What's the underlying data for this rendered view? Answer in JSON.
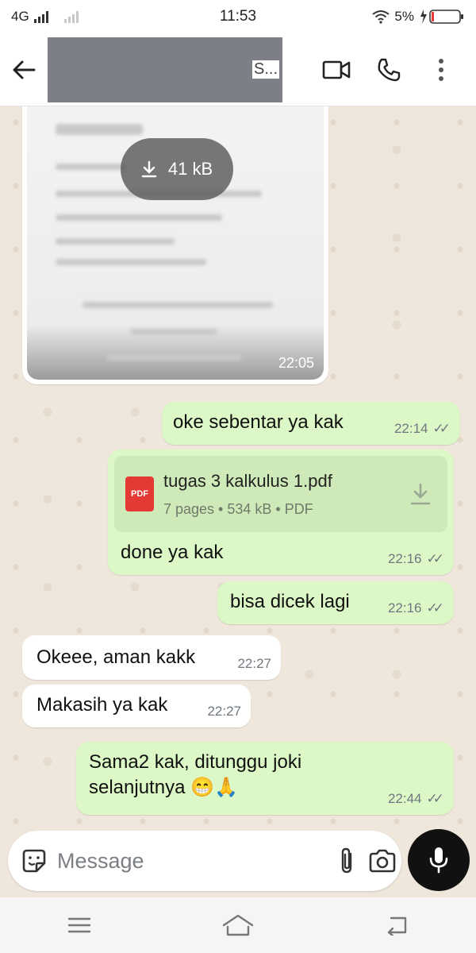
{
  "status_bar": {
    "network": "4G",
    "time": "11:53",
    "battery": "5%"
  },
  "header": {
    "contact_name_visible": "S..."
  },
  "image_message": {
    "download_size": "41 kB",
    "time": "22:05"
  },
  "messages": [
    {
      "dir": "out",
      "text": "oke sebentar ya kak",
      "time": "22:14"
    },
    {
      "dir": "out",
      "text": "done ya kak",
      "time": "22:16"
    },
    {
      "dir": "out",
      "text": "bisa dicek lagi",
      "time": "22:16"
    },
    {
      "dir": "in",
      "text": "Okeee, aman kakk",
      "time": "22:27"
    },
    {
      "dir": "in",
      "text": "Makasih ya kak",
      "time": "22:27"
    },
    {
      "dir": "out",
      "text_line1": "Sama2 kak, ditunggu joki",
      "text_line2": "selanjutnya 😁🙏",
      "time": "22:44"
    }
  ],
  "pdf": {
    "icon_label": "PDF",
    "name": "tugas 3 kalkulus 1.pdf",
    "info": "7 pages • 534 kB • PDF"
  },
  "input": {
    "placeholder": "Message"
  },
  "icons": {
    "back": "arrow-left-icon",
    "video": "video-call-icon",
    "call": "phone-icon",
    "menu": "more-vert-icon",
    "sticker": "sticker-icon",
    "attach": "paperclip-icon",
    "camera": "camera-icon",
    "mic": "microphone-icon",
    "download": "download-icon"
  },
  "colors": {
    "outgoing_bubble": "#dcf8c6",
    "incoming_bubble": "#ffffff",
    "chat_bg": "#efe7dc",
    "pdf_red": "#e53935"
  }
}
